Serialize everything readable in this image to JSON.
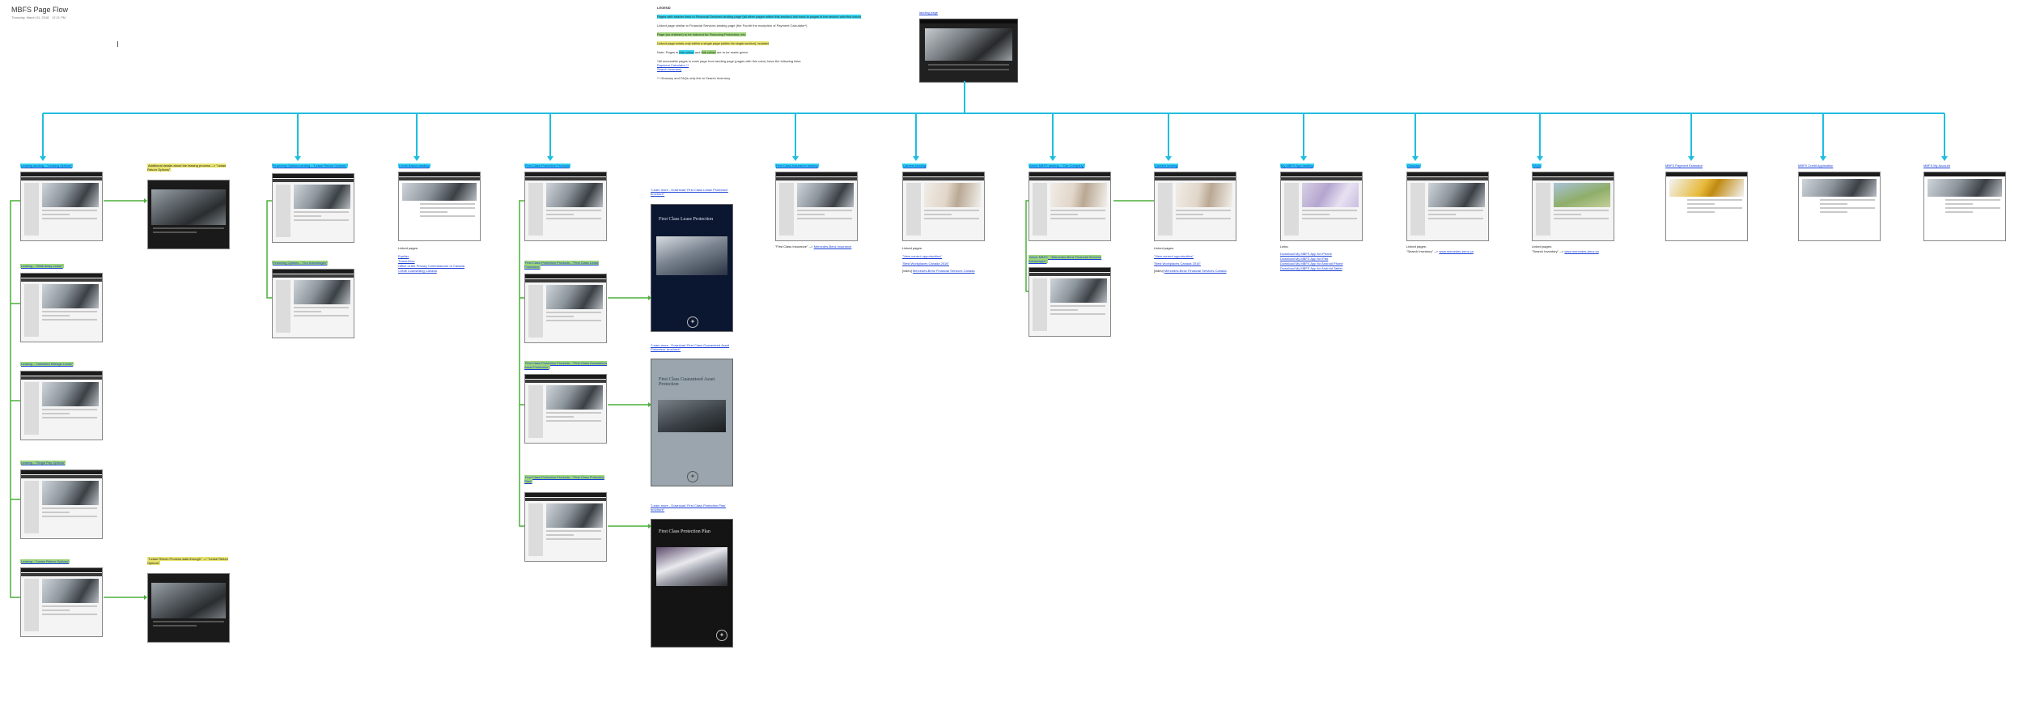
{
  "header": {
    "title": "MBFS Page Flow",
    "date": "Thursday, March 01, 2018",
    "time": "12:21 PM"
  },
  "legend": {
    "heading": "LEGEND",
    "line1_a": "Pages with ",
    "line1_b": "header",
    "line1_c": " links to Financial Services landing page (all other pages within this section) link back to pages in the section with ",
    "line1_d": "this colour",
    "line2": "Linked page similar to Financial Services landing page (the Fourth the exception of Payment Calculator*)",
    "line3": "Page (no children) to be indexed for Financing Protection, etc.",
    "line4": "Linked page exists only within a single page (within its single section), isolated",
    "line5_a": "Note: Pages in ",
    "line5_b": "this colour",
    "line5_c": " and ",
    "line5_d": "this colour",
    "line5_e": " are to be made green",
    "line6": "*All accessible pages in main page from landing page (pages with this color) have the following links:",
    "line6_links": [
      "Payment Calculator **",
      "Search Inventory"
    ],
    "line7": "** Glossary and FAQs only link to Search Inventory"
  },
  "hub": {
    "label": "landing page"
  },
  "columns": [
    {
      "label": "Leasing landing - \"Leasing Options\"",
      "hl": "cyan"
    },
    {
      "label": "Additional details about the leasing process --> \"Lease Return Options\"",
      "hl": "yellow"
    },
    {
      "label": "Financing Options landing - \"Lease Return Options\"",
      "hl": "cyan"
    },
    {
      "label": "Credit Basics landing",
      "hl": "cyan"
    },
    {
      "label": "First Class Protection Products",
      "hl": "cyan"
    },
    {
      "label": "\"Learn more - Download 'First Class Lease Protection' brochure\"",
      "hl": "none"
    },
    {
      "label": "First Class Insurance landing",
      "hl": "cyan"
    },
    {
      "label": "Careers landing",
      "hl": "cyan"
    },
    {
      "label": "About MBFS landing - \"Our Company\"",
      "hl": "cyan"
    },
    {
      "label": "Careers landing",
      "hl": "cyan"
    },
    {
      "label": "My MBFS App landing",
      "hl": "cyan"
    },
    {
      "label": "Glossary",
      "hl": "cyan"
    },
    {
      "label": "FAQs",
      "hl": "cyan"
    },
    {
      "label": "MBFS Payment Estimator",
      "hl": "none"
    },
    {
      "label": "MBFS Credit Application",
      "hl": "none"
    },
    {
      "label": "MBFS My Account",
      "hl": "none"
    }
  ],
  "leasing_children": [
    {
      "label": "Leasing - \"Walk Away Lease\"",
      "hl": "green"
    },
    {
      "label": "Leasing - \"Unlimited Mileage Lease\"",
      "hl": "green"
    },
    {
      "label": "Leasing - \"Single Pay Options\"",
      "hl": "green"
    },
    {
      "label": "Leasing - \"Lease Return Options\"",
      "hl": "green"
    }
  ],
  "lease_return_detail": {
    "label": "\"Lease Return Process walk-through\" --> \"Lease Return Options\"",
    "hl": "yellow"
  },
  "financing_child": {
    "label": "Financing Options - \"Our Advantages\"",
    "hl": "green"
  },
  "protection_children": [
    {
      "label": "First Class Protection Products - \"First Class Lease Protection\"",
      "hl": "green"
    },
    {
      "label": "First Class Protection Products - \"First Class Guaranteed Asset Protection\"",
      "hl": "green"
    },
    {
      "label": "First Class Protection Products - \"First Class Protection Plan\"",
      "hl": "green"
    }
  ],
  "brochures": [
    {
      "label": "\"Learn more - Download 'First Class Guaranteed Asset Protection' brochure\"",
      "title": "First Class Lease Protection"
    },
    {
      "label": "\"Learn more - Download 'First Class Protection Plan' brochure\"",
      "title": "First Class Guaranteed Asset Protection"
    },
    {
      "label": "",
      "title": "First Class Protection Plan"
    }
  ],
  "about_child": {
    "label": "About MBFS - \"Mercedes-Benz Financial Services Advantages\"",
    "hl": "green"
  },
  "notes": {
    "credit": {
      "heading": "Linked pages:",
      "links": [
        "Equifax",
        "TransUnion",
        "Office of the Privacy Commissioner of Canada",
        "Credit Counselling Canada"
      ]
    },
    "insurance": {
      "text": "\"First Class Insurance\" --> ",
      "link": "Mercedes-Benz Insurance"
    },
    "careers1": {
      "heading": "Linked pages:",
      "items": [
        "\"View current opportunities\"",
        "\"Best Workplaces Canada 2016\""
      ],
      "footer_prefix": "[video] ",
      "footer_link": "Mercedes-Benz Financial Services Canada"
    },
    "careers2": {
      "heading": "Linked pages:",
      "items": [
        "\"View current opportunities\"",
        "\"Best Workplaces Canada 2016\""
      ],
      "footer_prefix": "[video] ",
      "footer_link": "Mercedes-Benz Financial Services Canada"
    },
    "app": {
      "heading": "Links:",
      "links": [
        "Download My MBFS App for iPhone",
        "Download My MBFS App for iPad",
        "Download My MBFS App for Android Phone",
        "Download My MBFS App for Android Tablet"
      ]
    },
    "glossary": {
      "heading": "Linked pages:",
      "text": "\"Search Inventory\" --> ",
      "link": "www.mercedes-benz.ca"
    },
    "faqs": {
      "heading": "Linked pages:",
      "text": "\"Search Inventory\" --> ",
      "link": "www.mercedes-benz.ca"
    }
  },
  "colors": {
    "tree_line": "#1ebee0",
    "sub_line": "#4caf3a",
    "cyan_highlight": "#31d3ee",
    "green_highlight": "#9dd47a",
    "yellow_highlight": "#e8e46d"
  }
}
